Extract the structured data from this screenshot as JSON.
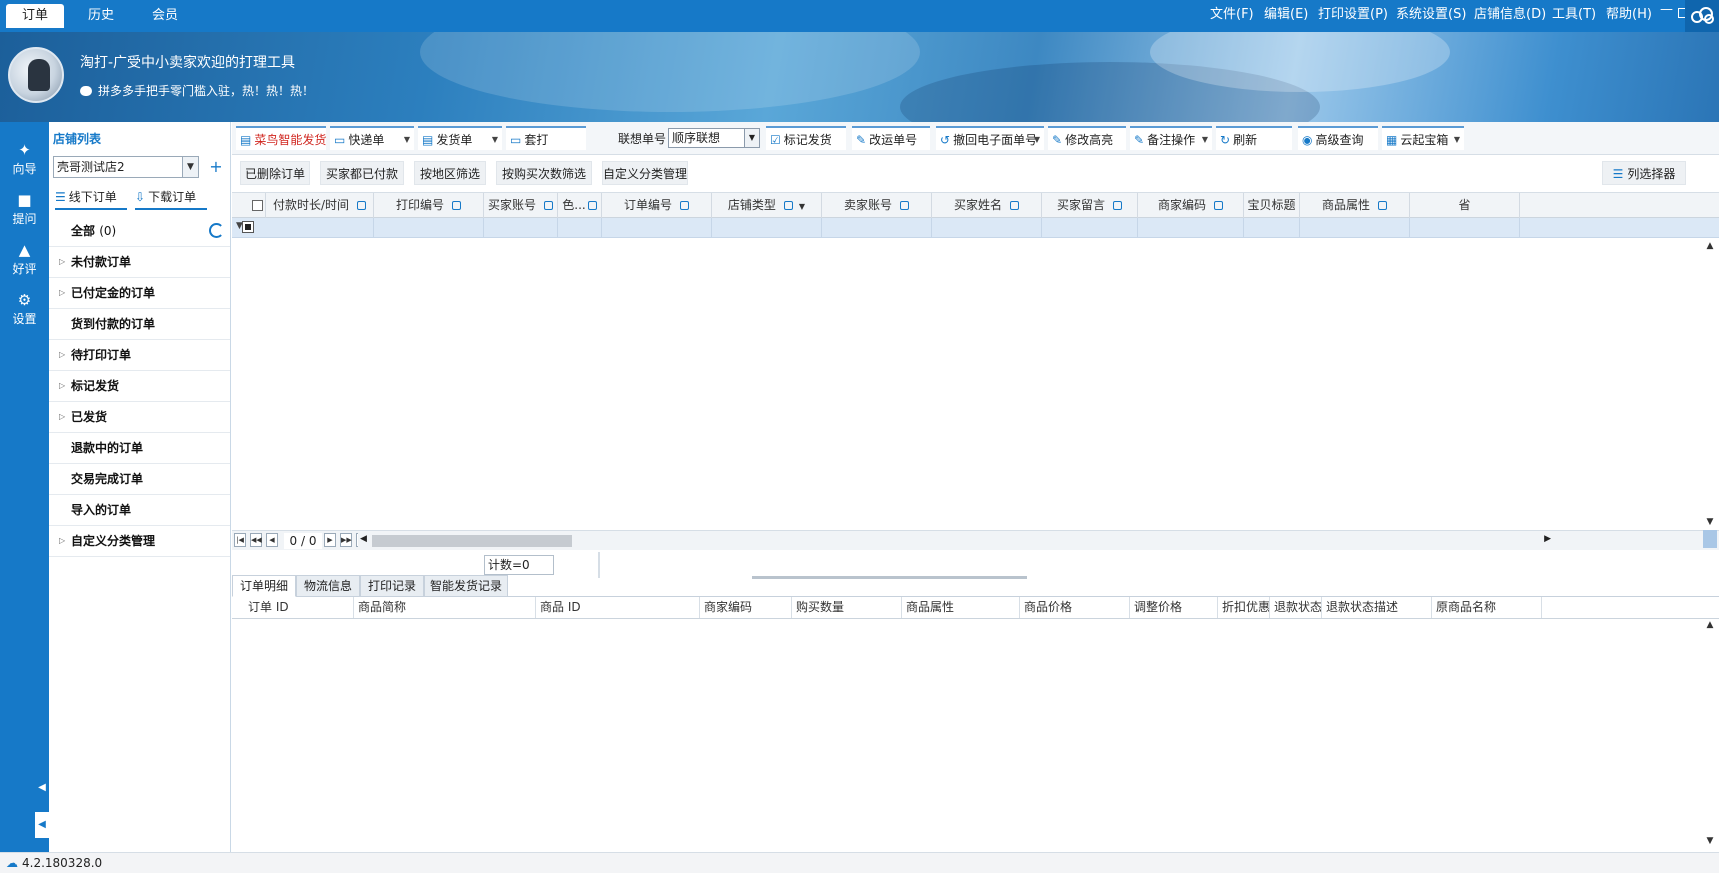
{
  "tabs": [
    {
      "label": "订单"
    },
    {
      "label": "历史"
    },
    {
      "label": "会员"
    }
  ],
  "menu": [
    "文件(F)",
    "编辑(E)",
    "打印设置(P)",
    "系统设置(S)",
    "店铺信息(D)",
    "工具(T)",
    "帮助(H)"
  ],
  "banner": {
    "title": "淘打-广受中小卖家欢迎的打理工具",
    "subtitle": "拼多多手把手零门槛入驻，热！热！热！"
  },
  "rail": [
    {
      "label": "向导",
      "icon": "wand-icon"
    },
    {
      "label": "提问",
      "icon": "question-icon"
    },
    {
      "label": "好评",
      "icon": "thumbs-up-icon"
    },
    {
      "label": "设置",
      "icon": "gear-icon"
    }
  ],
  "shop_panel": {
    "title": "店铺列表",
    "selected_shop": "壳哥测试店2",
    "offline_btn": "线下订单",
    "download_btn": "下载订单",
    "all_label": "全部",
    "all_count": "(0)",
    "items": [
      {
        "label": "未付款订单",
        "expandable": true
      },
      {
        "label": "已付定金的订单",
        "expandable": true
      },
      {
        "label": "货到付款的订单",
        "expandable": false
      },
      {
        "label": "待打印订单",
        "expandable": true
      },
      {
        "label": "标记发货",
        "expandable": true
      },
      {
        "label": "已发货",
        "expandable": true
      },
      {
        "label": "退款中的订单",
        "expandable": false
      },
      {
        "label": "交易完成订单",
        "expandable": false
      },
      {
        "label": "导入的订单",
        "expandable": false
      },
      {
        "label": "自定义分类管理",
        "expandable": true
      }
    ]
  },
  "toolbar": {
    "cainiao": "菜鸟智能发货",
    "express": "快递单",
    "invoice": "发货单",
    "set_print": "套打",
    "assoc_label": "联想单号",
    "assoc_value": "顺序联想",
    "mark_ship": "标记发货",
    "change_ship": "改运单号",
    "revoke": "撤回电子面单号",
    "modify_highlight": "修改高亮",
    "remark": "备注操作",
    "refresh": "刷新",
    "advanced_query": "高级查询",
    "cloud_box": "云起宝箱"
  },
  "toolbar2": {
    "deleted": "已删除订单",
    "buyer_paid": "买家都已付款",
    "region_filter": "按地区筛选",
    "times_filter": "按购买次数筛选",
    "custom_category": "自定义分类管理",
    "column_selector": "列选择器"
  },
  "grid_columns": [
    "付款时长/时间",
    "打印编号",
    "买家账号",
    "色...",
    "订单编号",
    "店铺类型",
    "卖家账号",
    "买家姓名",
    "买家留言",
    "商家编码",
    "宝贝标题",
    "商品属性",
    "省"
  ],
  "pager": {
    "text": "0 / 0"
  },
  "count_text": "计数=0",
  "detail_tabs": [
    "订单明细",
    "物流信息",
    "打印记录",
    "智能发货记录"
  ],
  "detail_columns": [
    "订单 ID",
    "商品简称",
    "商品 ID",
    "商家编码",
    "购买数量",
    "商品属性",
    "商品价格",
    "调整价格",
    "折扣优惠",
    "退款状态",
    "退款状态描述",
    "原商品名称"
  ],
  "status": {
    "version": "4.2.180328.0"
  },
  "colors": {
    "accent": "#1679c8",
    "danger": "#d0261f"
  }
}
